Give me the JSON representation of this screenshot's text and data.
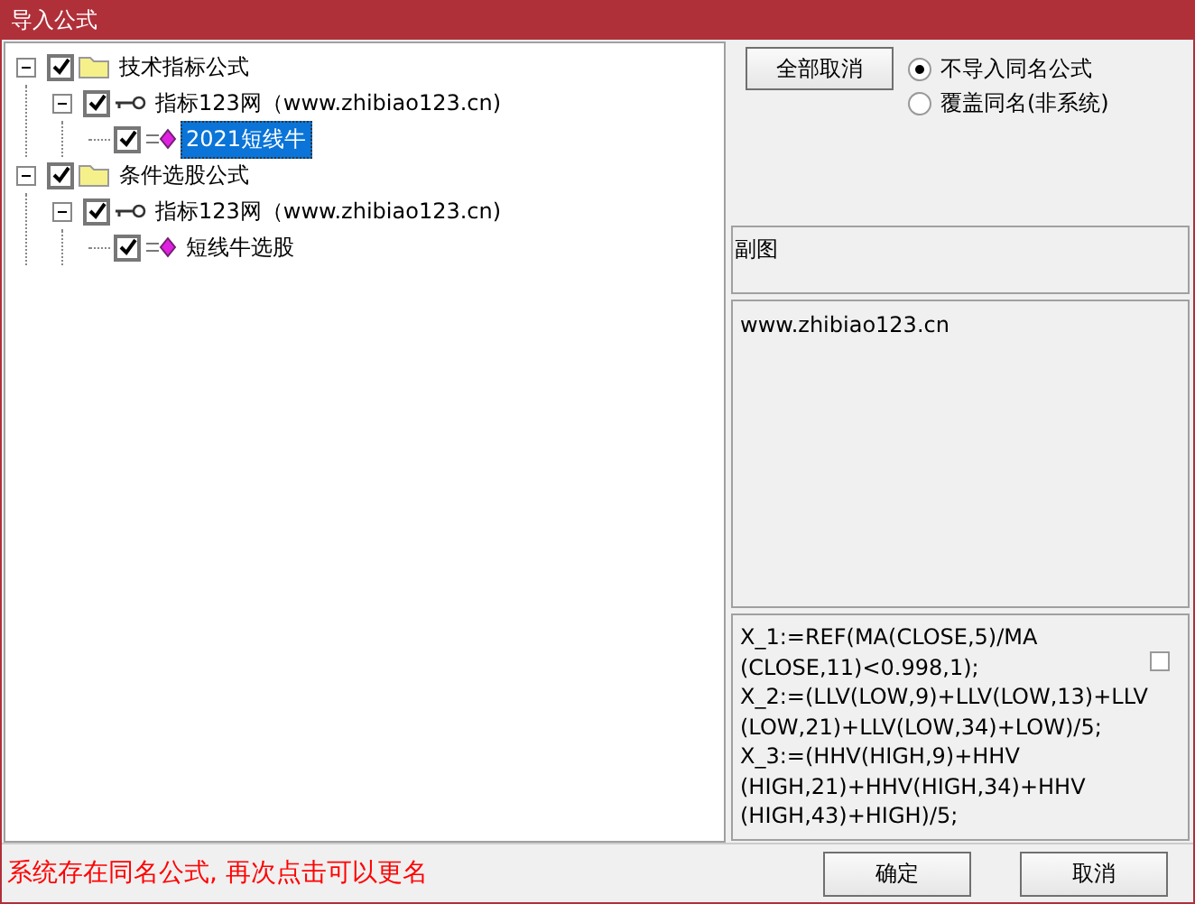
{
  "window": {
    "title": "导入公式"
  },
  "tree": [
    {
      "label": "技术指标公式",
      "kind": "folder",
      "checked": true,
      "expanded": true,
      "selected": false,
      "children": [
        {
          "label": "指标123网（www.zhibiao123.cn)",
          "kind": "key",
          "checked": true,
          "expanded": true,
          "selected": false,
          "children": [
            {
              "label": "2021短线牛",
              "kind": "formula",
              "checked": true,
              "selected": true
            }
          ]
        }
      ]
    },
    {
      "label": "条件选股公式",
      "kind": "folder",
      "checked": true,
      "expanded": true,
      "selected": false,
      "children": [
        {
          "label": "指标123网（www.zhibiao123.cn)",
          "kind": "key",
          "checked": true,
          "expanded": true,
          "selected": false,
          "children": [
            {
              "label": "短线牛选股",
              "kind": "formula",
              "checked": true,
              "selected": false
            }
          ]
        }
      ]
    }
  ],
  "cancel_all_button": "全部取消",
  "radios": [
    {
      "label": "不导入同名公式",
      "selected": true
    },
    {
      "label": "覆盖同名(非系统)",
      "selected": false
    }
  ],
  "chart_type": "副图",
  "description": "www.zhibiao123.cn",
  "formula_lines": [
    "X_1:=REF(MA(CLOSE,5)/MA",
    "(CLOSE,11)<0.998,1);",
    "X_2:=(LLV(LOW,9)+LLV(LOW,13)+LLV",
    "(LOW,21)+LLV(LOW,34)+LOW)/5;",
    "X_3:=(HHV(HIGH,9)+HHV",
    "(HIGH,21)+HHV(HIGH,34)+HHV",
    "(HIGH,43)+HIGH)/5;"
  ],
  "formula_checkbox": {
    "checked": false
  },
  "message": "系统存在同名公式, 再次点击可以更名",
  "buttons": [
    "确定",
    "取消"
  ]
}
